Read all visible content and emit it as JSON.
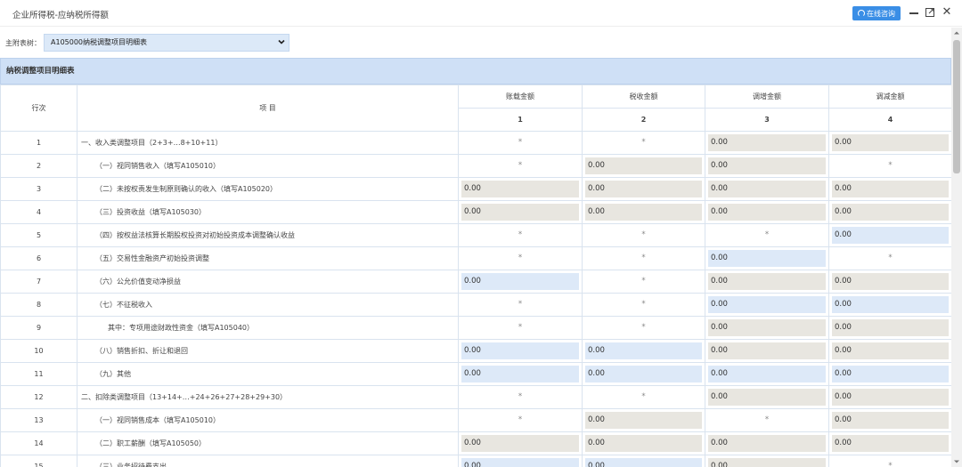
{
  "window": {
    "title": "企业所得税-应纳税所得额",
    "consult_label": "在线咨询"
  },
  "selector": {
    "label": "主附表树：",
    "value": "A105000纳税调整项目明细表"
  },
  "table": {
    "section_title": "纳税调整项目明细表",
    "headers": {
      "row_no": "行次",
      "item": "项 目",
      "col1": "账载金额",
      "col2": "税收金额",
      "col3": "调增金额",
      "col4": "调减金额",
      "num1": "1",
      "num2": "2",
      "num3": "3",
      "num4": "4"
    },
    "rows": [
      {
        "no": "1",
        "item": "一、收入类调整项目（2+3+…8+10+11）",
        "indent": 0,
        "cells": [
          {
            "t": "star",
            "v": "*"
          },
          {
            "t": "star",
            "v": "*"
          },
          {
            "t": "gray",
            "v": "0.00"
          },
          {
            "t": "gray",
            "v": "0.00"
          }
        ]
      },
      {
        "no": "2",
        "item": "（一）视同销售收入（填写A105010）",
        "indent": 1,
        "cells": [
          {
            "t": "star",
            "v": "*"
          },
          {
            "t": "gray",
            "v": "0.00"
          },
          {
            "t": "gray",
            "v": "0.00"
          },
          {
            "t": "star",
            "v": "*"
          }
        ]
      },
      {
        "no": "3",
        "item": "（二）未按权责发生制原则确认的收入（填写A105020）",
        "indent": 1,
        "cells": [
          {
            "t": "gray",
            "v": "0.00"
          },
          {
            "t": "gray",
            "v": "0.00"
          },
          {
            "t": "gray",
            "v": "0.00"
          },
          {
            "t": "gray",
            "v": "0.00"
          }
        ]
      },
      {
        "no": "4",
        "item": "（三）投资收益（填写A105030）",
        "indent": 1,
        "cells": [
          {
            "t": "gray",
            "v": "0.00"
          },
          {
            "t": "gray",
            "v": "0.00"
          },
          {
            "t": "gray",
            "v": "0.00"
          },
          {
            "t": "gray",
            "v": "0.00"
          }
        ]
      },
      {
        "no": "5",
        "item": "（四）按权益法核算长期股权投资对初始投资成本调整确认收益",
        "indent": 1,
        "cells": [
          {
            "t": "star",
            "v": "*"
          },
          {
            "t": "star",
            "v": "*"
          },
          {
            "t": "star",
            "v": "*"
          },
          {
            "t": "blue",
            "v": "0.00"
          }
        ]
      },
      {
        "no": "6",
        "item": "（五）交易性金融资产初始投资调整",
        "indent": 1,
        "cells": [
          {
            "t": "star",
            "v": "*"
          },
          {
            "t": "star",
            "v": "*"
          },
          {
            "t": "blue",
            "v": "0.00"
          },
          {
            "t": "star",
            "v": "*"
          }
        ]
      },
      {
        "no": "7",
        "item": "（六）公允价值变动净损益",
        "indent": 1,
        "cells": [
          {
            "t": "blue",
            "v": "0.00"
          },
          {
            "t": "star",
            "v": "*"
          },
          {
            "t": "gray",
            "v": "0.00"
          },
          {
            "t": "gray",
            "v": "0.00"
          }
        ]
      },
      {
        "no": "8",
        "item": "（七）不征税收入",
        "indent": 1,
        "cells": [
          {
            "t": "star",
            "v": "*"
          },
          {
            "t": "star",
            "v": "*"
          },
          {
            "t": "blue",
            "v": "0.00"
          },
          {
            "t": "blue",
            "v": "0.00"
          }
        ]
      },
      {
        "no": "9",
        "item": "其中：专项用途财政性资金（填写A105040）",
        "indent": 2,
        "cells": [
          {
            "t": "star",
            "v": "*"
          },
          {
            "t": "star",
            "v": "*"
          },
          {
            "t": "gray",
            "v": "0.00"
          },
          {
            "t": "gray",
            "v": "0.00"
          }
        ]
      },
      {
        "no": "10",
        "item": "（八）销售折扣、折让和退回",
        "indent": 1,
        "cells": [
          {
            "t": "blue",
            "v": "0.00"
          },
          {
            "t": "blue",
            "v": "0.00"
          },
          {
            "t": "gray",
            "v": "0.00"
          },
          {
            "t": "gray",
            "v": "0.00"
          }
        ]
      },
      {
        "no": "11",
        "item": "（九）其他",
        "indent": 1,
        "cells": [
          {
            "t": "blue",
            "v": "0.00"
          },
          {
            "t": "blue",
            "v": "0.00"
          },
          {
            "t": "blue",
            "v": "0.00"
          },
          {
            "t": "blue",
            "v": "0.00"
          }
        ]
      },
      {
        "no": "12",
        "item": "二、扣除类调整项目（13+14+…+24+26+27+28+29+30）",
        "indent": 0,
        "cells": [
          {
            "t": "star",
            "v": "*"
          },
          {
            "t": "star",
            "v": "*"
          },
          {
            "t": "gray",
            "v": "0.00"
          },
          {
            "t": "gray",
            "v": "0.00"
          }
        ]
      },
      {
        "no": "13",
        "item": "（一）视同销售成本（填写A105010）",
        "indent": 1,
        "cells": [
          {
            "t": "star",
            "v": "*"
          },
          {
            "t": "gray",
            "v": "0.00"
          },
          {
            "t": "star",
            "v": "*"
          },
          {
            "t": "gray",
            "v": "0.00"
          }
        ]
      },
      {
        "no": "14",
        "item": "（二）职工薪酬（填写A105050）",
        "indent": 1,
        "cells": [
          {
            "t": "gray",
            "v": "0.00"
          },
          {
            "t": "gray",
            "v": "0.00"
          },
          {
            "t": "gray",
            "v": "0.00"
          },
          {
            "t": "gray",
            "v": "0.00"
          }
        ]
      },
      {
        "no": "15",
        "item": "（三）业务招待费支出",
        "indent": 1,
        "cells": [
          {
            "t": "blue",
            "v": "0.00"
          },
          {
            "t": "blue",
            "v": "0.00"
          },
          {
            "t": "gray",
            "v": "0.00"
          },
          {
            "t": "star",
            "v": "*"
          }
        ]
      }
    ]
  }
}
